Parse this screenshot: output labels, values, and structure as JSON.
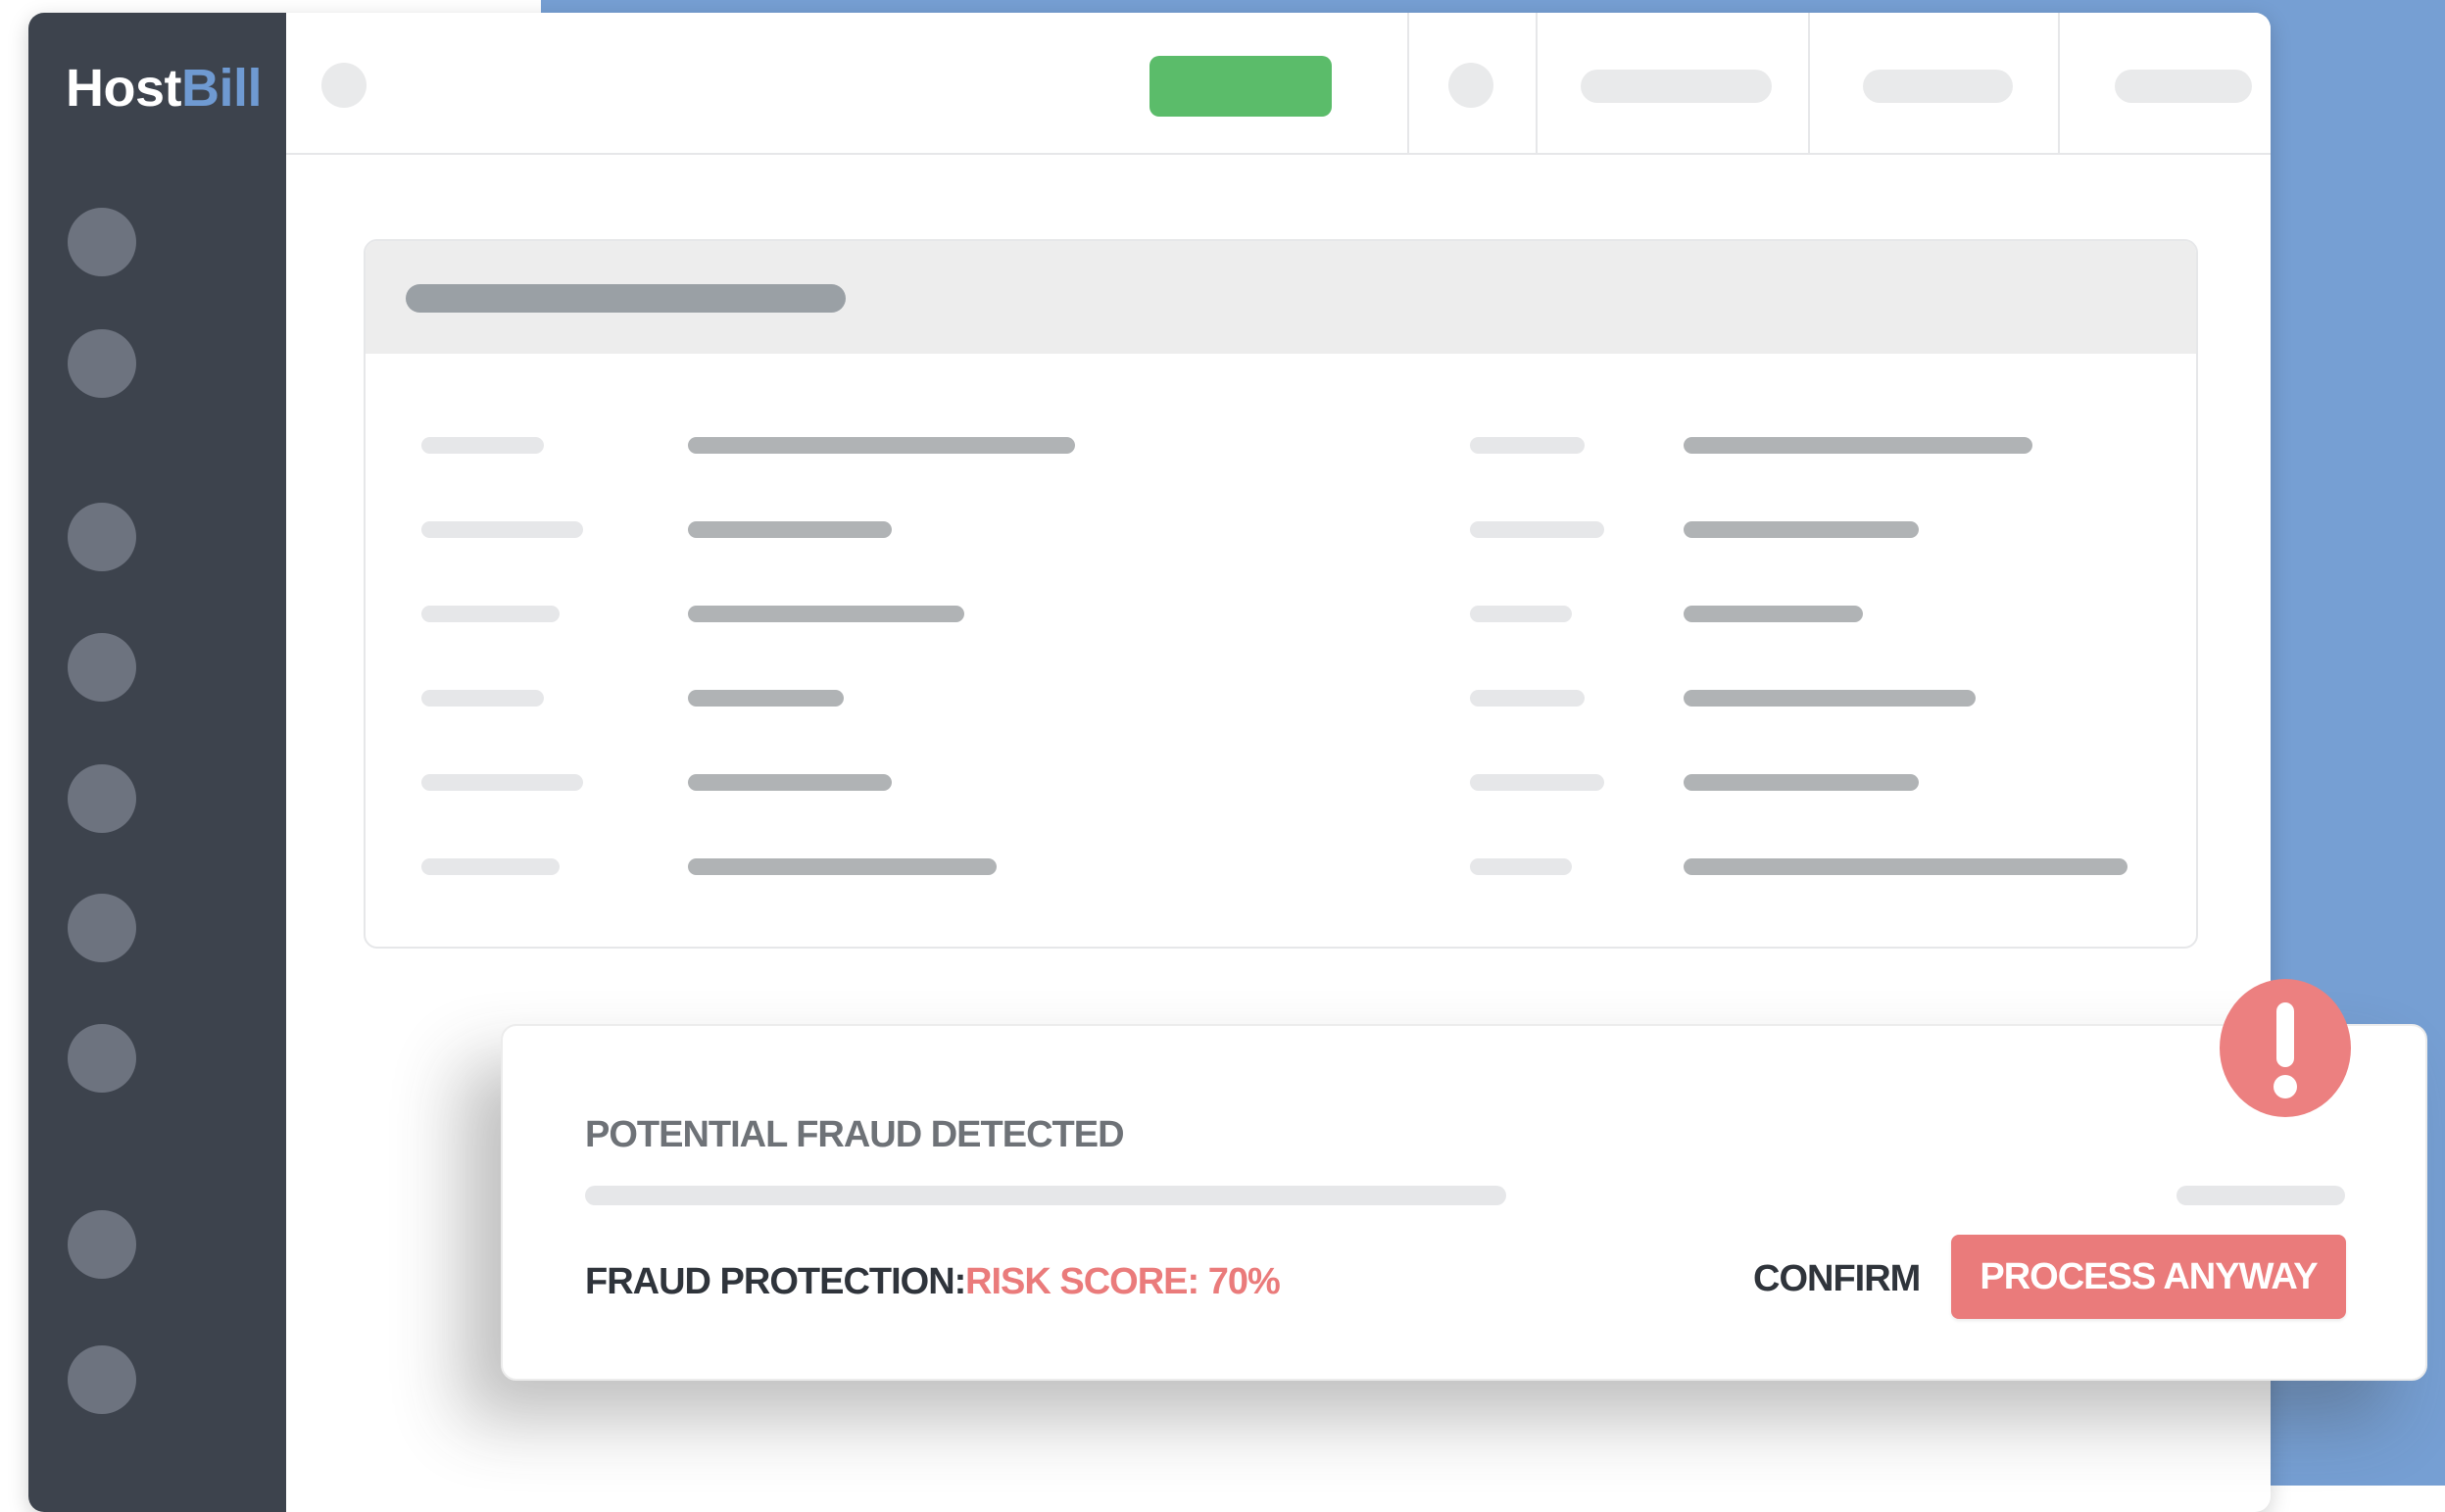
{
  "brand": {
    "logo_part1": "Host",
    "logo_part2": "Bill"
  },
  "alert": {
    "title": "POTENTIAL FRAUD DETECTED",
    "fraud_protection_label": "FRAUD PROTECTION:",
    "risk_score_text": "RISK SCORE: 70%",
    "confirm_label": "CONFIRM",
    "process_anyway_label": "PROCESS ANYWAY",
    "icon": "exclamation-icon"
  },
  "colors": {
    "sidebar": "#3d434d",
    "accent_blue": "#769fd3",
    "primary_green": "#5bbc6a",
    "danger_red": "#ea7b7b"
  }
}
